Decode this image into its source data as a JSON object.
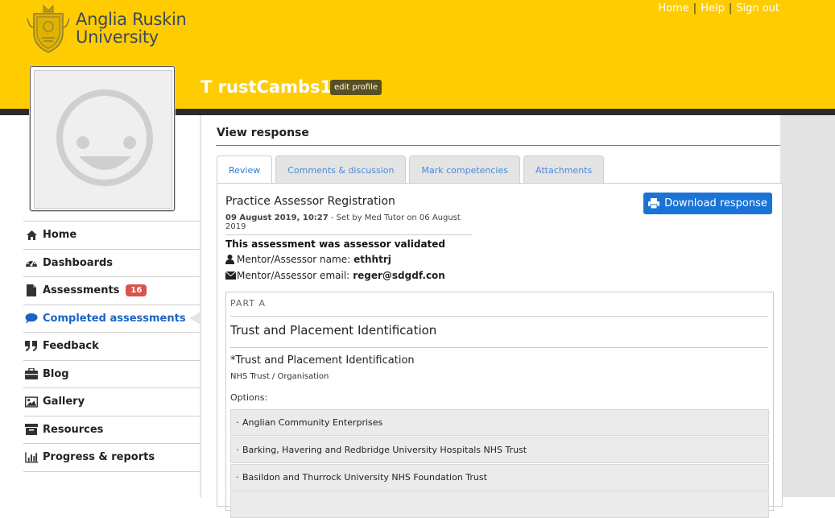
{
  "header": {
    "logo_line1": "Anglia Ruskin",
    "logo_line2": "University",
    "links": [
      "Home",
      "Help",
      "Sign out"
    ],
    "username": "T rustCambs1",
    "edit_profile": "edit profile"
  },
  "sidebar": {
    "items": [
      {
        "label": "Home",
        "icon": "home-icon"
      },
      {
        "label": "Dashboards",
        "icon": "dashboard-icon"
      },
      {
        "label": "Assessments",
        "icon": "file-icon",
        "badge": "16"
      },
      {
        "label": "Completed assessments",
        "icon": "comment-icon"
      },
      {
        "label": "Feedback",
        "icon": "quote-icon"
      },
      {
        "label": "Blog",
        "icon": "briefcase-icon"
      },
      {
        "label": "Gallery",
        "icon": "image-icon"
      },
      {
        "label": "Resources",
        "icon": "archive-icon"
      },
      {
        "label": "Progress & reports",
        "icon": "bar-chart-icon"
      }
    ],
    "active_index": 3
  },
  "main": {
    "title": "View response",
    "tabs": [
      "Review",
      "Comments & discussion",
      "Mark competencies",
      "Attachments"
    ],
    "active_tab": 0,
    "assessment_title": "Practice Assessor Registration",
    "meta_date": "09 August 2019, 10:27",
    "meta_rest": " - Set by Med Tutor on 06 August 2019",
    "download_label": "Download response",
    "validated_text": "This assessment was assessor validated",
    "mentor_name_label": "Mentor/Assessor name:",
    "mentor_name": "ethhtrj",
    "mentor_email_label": "Mentor/Assessor email:",
    "mentor_email": "reger@sdgdf.con",
    "part_label": "PART A",
    "section_title": "Trust and Placement Identification",
    "question_title": "*Trust and Placement Identification",
    "question_sub": "NHS Trust / Organisation",
    "options_label": "Options:",
    "options": [
      "Anglian Community Enterprises",
      "Barking, Havering and Redbridge University Hospitals NHS Trust",
      "Basildon and Thurrock University NHS Foundation Trust"
    ]
  },
  "colors": {
    "brand_yellow": "#fecc00",
    "link_blue": "#1a63c7",
    "button_blue": "#1a73d6",
    "badge_red": "#d9534f"
  }
}
